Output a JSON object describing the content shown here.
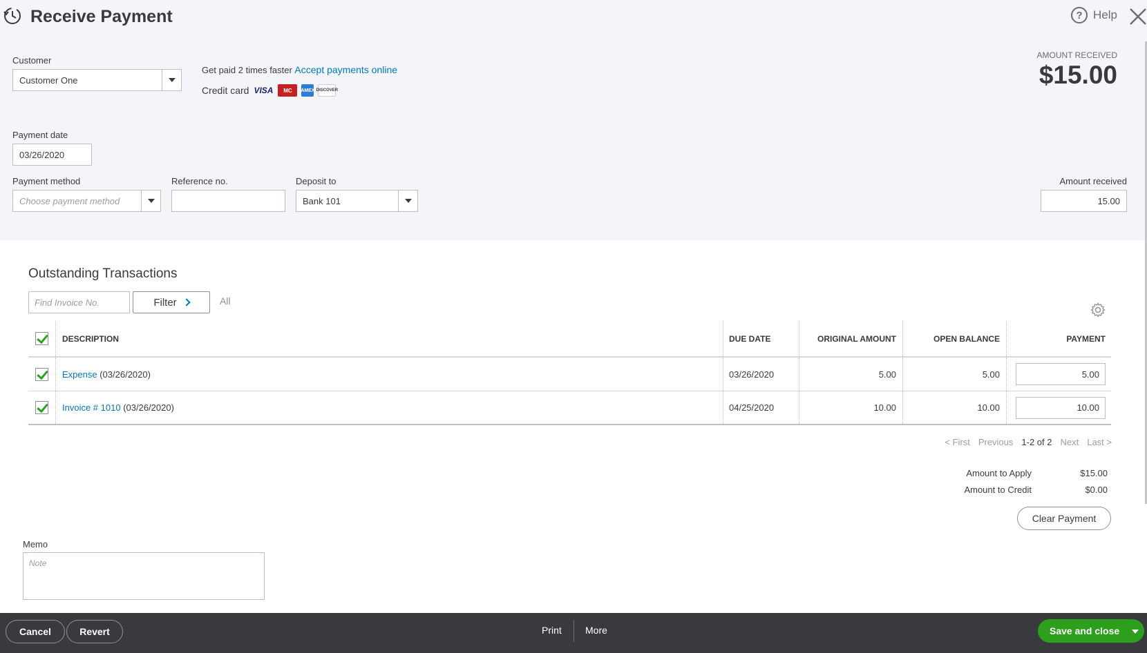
{
  "header": {
    "title": "Receive Payment",
    "help_label": "Help"
  },
  "customer": {
    "label": "Customer",
    "value": "Customer One"
  },
  "promo": {
    "text": "Get paid 2 times faster",
    "link": "Accept payments online",
    "cc_label": "Credit card",
    "cards": [
      "VISA",
      "MC",
      "AMEX",
      "DISCOVER"
    ]
  },
  "amount_received_header": {
    "label": "AMOUNT RECEIVED",
    "value": "$15.00"
  },
  "payment_date": {
    "label": "Payment date",
    "value": "03/26/2020"
  },
  "payment_method": {
    "label": "Payment method",
    "placeholder": "Choose payment method"
  },
  "reference": {
    "label": "Reference no.",
    "value": ""
  },
  "deposit_to": {
    "label": "Deposit to",
    "value": "Bank 101"
  },
  "amount_received": {
    "label": "Amount received",
    "value": "15.00"
  },
  "outstanding": {
    "title": "Outstanding Transactions",
    "find_placeholder": "Find Invoice No.",
    "filter_label": "Filter",
    "all_label": "All",
    "columns": {
      "description": "DESCRIPTION",
      "due_date": "DUE DATE",
      "original_amount": "ORIGINAL AMOUNT",
      "open_balance": "OPEN BALANCE",
      "payment": "PAYMENT"
    },
    "rows": [
      {
        "link": "Expense",
        "date_suffix": "(03/26/2020)",
        "due_date": "03/26/2020",
        "original": "5.00",
        "open": "5.00",
        "payment": "5.00"
      },
      {
        "link": "Invoice # 1010",
        "date_suffix": "(03/26/2020)",
        "due_date": "04/25/2020",
        "original": "10.00",
        "open": "10.00",
        "payment": "10.00"
      }
    ],
    "pager": {
      "first": "< First",
      "previous": "Previous",
      "range": "1-2 of 2",
      "next": "Next",
      "last": "Last >"
    }
  },
  "totals": {
    "apply_label": "Amount to Apply",
    "apply_value": "$15.00",
    "credit_label": "Amount to Credit",
    "credit_value": "$0.00"
  },
  "clear_payment_label": "Clear Payment",
  "memo": {
    "label": "Memo",
    "placeholder": "Note"
  },
  "footer": {
    "cancel": "Cancel",
    "revert": "Revert",
    "print": "Print",
    "more": "More",
    "save": "Save and close"
  },
  "colors": {
    "accent_link": "#0077c5",
    "save_green": "#2ca01c",
    "footer_bg": "#393a3d",
    "top_bg": "#f4f5f8"
  }
}
